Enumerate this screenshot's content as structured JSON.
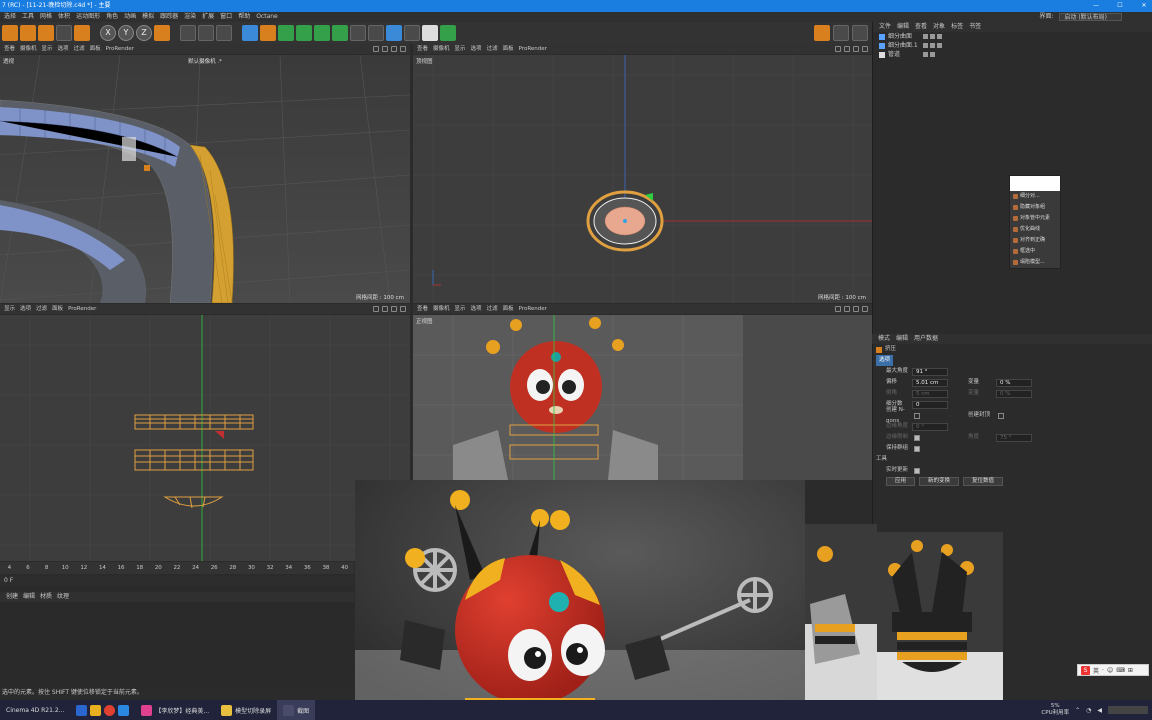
{
  "window": {
    "title": "7 (RC) - [11-21-晚检切除.c4d *] - 主要",
    "controls": [
      "—",
      "☐",
      "✕"
    ]
  },
  "menubar": {
    "items": [
      "选择",
      "工具",
      "网格",
      "体积",
      "运动图形",
      "角色",
      "动画",
      "模拟",
      "跟踪器",
      "渲染",
      "扩展",
      "窗口",
      "帮助",
      "Octane"
    ],
    "layout_label": "界面:",
    "layout_value": "启动 (默认布局)"
  },
  "toolbar": {
    "axis_x": "X",
    "axis_y": "Y",
    "axis_z": "Z"
  },
  "viewports": {
    "perspective": {
      "menu": [
        "查看",
        "摄像机",
        "显示",
        "选项",
        "过滤",
        "面板",
        "ProRender"
      ],
      "corner_label": "透视",
      "camera_label": "默认摄像机 .*",
      "grid": "网格间距 : 100 cm"
    },
    "top": {
      "menu": [
        "查看",
        "摄像机",
        "显示",
        "选项",
        "过滤",
        "面板",
        "ProRender"
      ],
      "label": "顶视图",
      "grid": "网格间距 : 100 cm"
    },
    "right": {
      "menu": [
        "显示",
        "选项",
        "过滤",
        "面板",
        "ProRender"
      ]
    },
    "front": {
      "menu": [
        "查看",
        "摄像机",
        "显示",
        "选项",
        "过滤",
        "面板",
        "ProRender"
      ],
      "label": "正视图"
    }
  },
  "timeline": {
    "ticks": [
      "4",
      "6",
      "8",
      "10",
      "12",
      "14",
      "16",
      "18",
      "20",
      "22",
      "24",
      "26",
      "28",
      "30",
      "32",
      "34",
      "36",
      "38",
      "40"
    ],
    "frame": "0 F"
  },
  "material_tabs": [
    "创建",
    "编辑",
    "材质",
    "纹理"
  ],
  "status": "选中的元素。按住 SHIFT 键使位移锁定于当前元素。",
  "object_manager": {
    "tabs": [
      "文件",
      "编辑",
      "查看",
      "对象",
      "标签",
      "书签"
    ],
    "objects": [
      {
        "name": "细分曲面"
      },
      {
        "name": "细分曲面.1"
      },
      {
        "name": "管道"
      }
    ]
  },
  "context_menu": {
    "items": [
      "细分对...",
      "隐藏对象组",
      "对象管中元素",
      "优化曲线",
      "对齐到正确",
      "框选中",
      "塌陷模型..."
    ]
  },
  "attributes": {
    "tabs": [
      "模式",
      "编辑",
      "用户数据"
    ],
    "object_name": "挤压",
    "section_options": "选项",
    "fields": {
      "max_angle": {
        "label": "最大角度",
        "value": "91 °"
      },
      "offset": {
        "label": "偏移",
        "value": "5.01 cm"
      },
      "bevel": {
        "label": "倒角",
        "value": "5 cm"
      },
      "subdivision": {
        "label": "细分数",
        "value": "0"
      },
      "variance": {
        "label": "变量",
        "value": "0 %"
      },
      "variance2": {
        "label": "变量",
        "value": "0 %"
      },
      "create_ngons": {
        "label": "创建 N-gons"
      },
      "create_caps": {
        "label": "创建封顶"
      },
      "edge_angle": {
        "label": "边缘角度",
        "value": "0 °"
      },
      "edge_limit": {
        "label": "边缘限制"
      },
      "keep_groups": {
        "label": "保持群组"
      },
      "angle": {
        "label": "角度",
        "value": "75 °"
      }
    },
    "section_tool": "工具",
    "realtime_label": "实时更新",
    "buttons": [
      "应用",
      "新的变换",
      "复位数值"
    ]
  },
  "taskbar": {
    "start_label": "Cinema 4D R21.2...",
    "tasks": [
      "【李欣梦】经典美...",
      "模型切除录屏",
      "截图"
    ],
    "cpu": "5%",
    "cpu_label": "CPU利用率"
  },
  "ime": {
    "items": [
      "S",
      "英",
      "·",
      "☺",
      "⌨",
      "⊞"
    ]
  }
}
